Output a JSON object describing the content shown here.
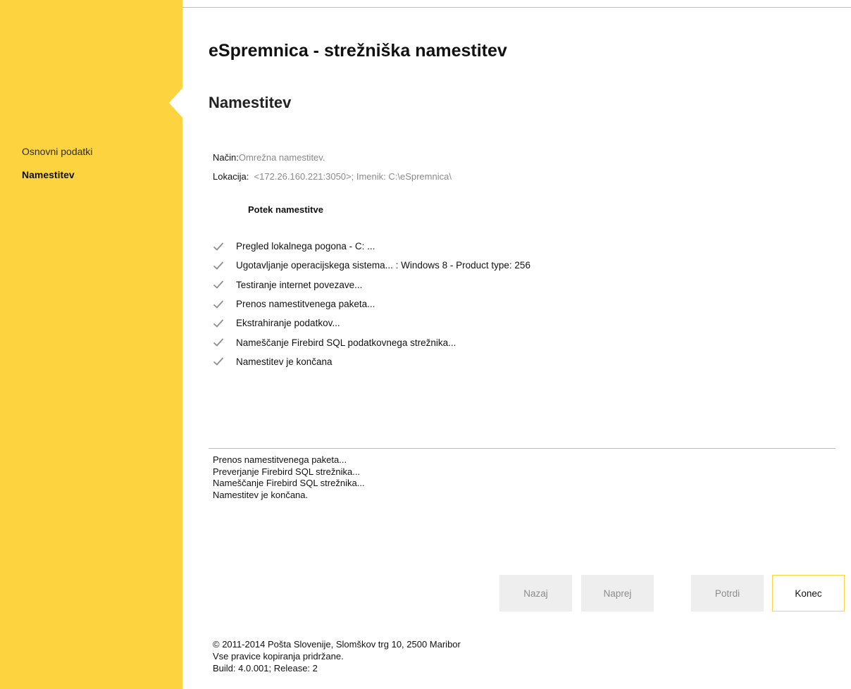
{
  "app": {
    "title": "eSpremnica - strežniška namestitev"
  },
  "sidebar": {
    "items": [
      {
        "label": "Osnovni podatki",
        "active": false
      },
      {
        "label": "Namestitev",
        "active": true
      }
    ],
    "color": "#fdd43f"
  },
  "section": {
    "title": "Namestitev"
  },
  "info": {
    "mode_label": "Način:",
    "mode_value": "Omrežna namestitev.",
    "location_label": "Lokacija:",
    "location_value": "<172.26.160.221:3050>; Imenik: C:\\eSpremnica\\"
  },
  "steps": {
    "heading": "Potek namestitve",
    "items": [
      {
        "label": "Pregled lokalnega pogona - C: ...",
        "icon": "check-icon"
      },
      {
        "label": "Ugotavljanje operacijskega sistema... : Windows 8  - Product type: 256",
        "icon": "check-icon"
      },
      {
        "label": "Testiranje internet povezave...",
        "icon": "check-icon"
      },
      {
        "label": "Prenos namestitvenega paketa...",
        "icon": "check-icon"
      },
      {
        "label": "Ekstrahiranje podatkov...",
        "icon": "check-icon"
      },
      {
        "label": "Nameščanje Firebird SQL podatkovnega strežnika...",
        "icon": "check-icon"
      },
      {
        "label": "Namestitev je končana",
        "icon": "check-icon"
      }
    ]
  },
  "log": {
    "lines": [
      "Prenos namestitvenega paketa...",
      "Preverjanje Firebird SQL strežnika...",
      "Nameščanje Firebird SQL strežnika...",
      "Namestitev je končana."
    ]
  },
  "buttons": {
    "back": "Nazaj",
    "next": "Naprej",
    "confirm": "Potrdi",
    "finish": "Konec"
  },
  "footer": {
    "copyright": "© 2011-2014 Pošta Slovenije, Slomškov trg 10, 2500 Maribor",
    "rights": "Vse pravice kopiranja pridržane.",
    "build": "Build: 4.0.001; Release: 2"
  }
}
